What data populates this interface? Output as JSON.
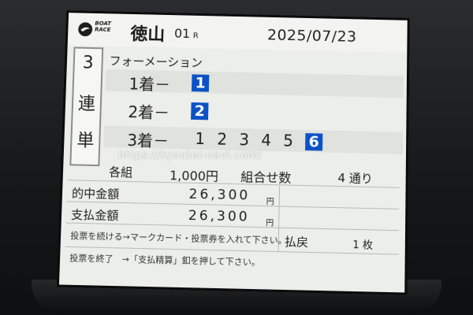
{
  "header": {
    "logo_text_line1": "BOAT",
    "logo_text_line2": "RACE",
    "venue": "徳山",
    "race_number": "01",
    "race_suffix": "R",
    "date": "2025/07/23"
  },
  "bet_type": {
    "chars": [
      "3",
      "連",
      "単"
    ],
    "method": "フォーメーション"
  },
  "selections": [
    {
      "label": "1着－",
      "numbers": [
        {
          "value": "1",
          "selected": true
        }
      ]
    },
    {
      "label": "2着－",
      "numbers": [
        {
          "value": "2",
          "selected": true
        }
      ]
    },
    {
      "label": "3着－",
      "numbers": [
        {
          "value": "1",
          "selected": false
        },
        {
          "value": "2",
          "selected": false
        },
        {
          "value": "3",
          "selected": false
        },
        {
          "value": "4",
          "selected": false
        },
        {
          "value": "5",
          "selected": false
        },
        {
          "value": "6",
          "selected": true
        }
      ]
    }
  ],
  "per_set": {
    "label": "各組",
    "amount": "1,000円"
  },
  "combinations": {
    "label": "組合せ数",
    "value": "4 通り"
  },
  "hit_amount": {
    "label": "的中金額",
    "value": "26,300",
    "unit": "円"
  },
  "payout_amount": {
    "label": "支払金額",
    "value": "26,300",
    "unit": "円"
  },
  "refund": {
    "label": "払戻",
    "value": "1 枚"
  },
  "instructions": [
    "投票を続ける→マークカード・投票券を入れて下さい。",
    "投票を終了　→「支払精算」釦を押して下さい。"
  ],
  "watermark": "https://kyoutei-navi.com/",
  "colors": {
    "selected_bg": "#0b52c8",
    "screen_bg": "#eceeea"
  }
}
